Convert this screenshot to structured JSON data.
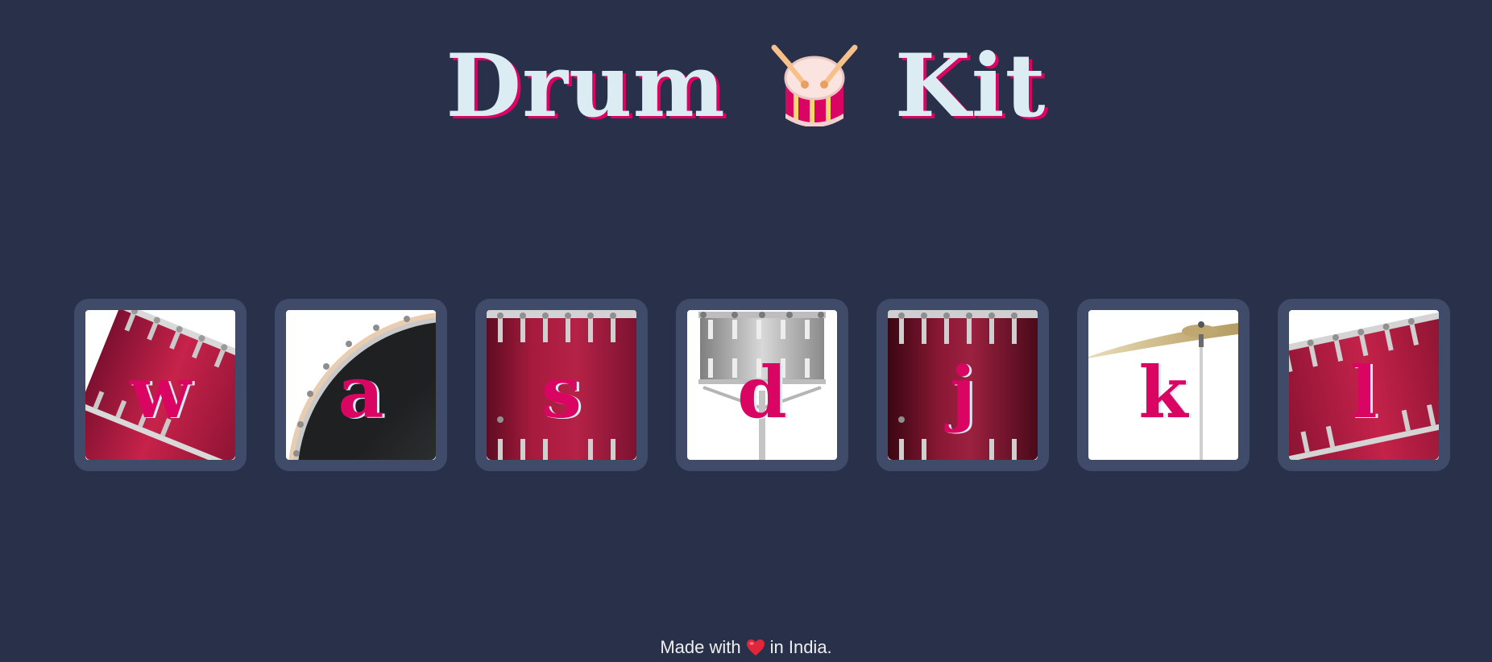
{
  "page": {
    "title_left": "Drum",
    "title_right": "Kit",
    "title_icon": "drum-icon"
  },
  "drums": [
    {
      "key": "w",
      "art": "tom-tilted",
      "label_name": "drum-w"
    },
    {
      "key": "a",
      "art": "crash-drum",
      "label_name": "drum-a"
    },
    {
      "key": "s",
      "art": "snare-red",
      "label_name": "drum-s"
    },
    {
      "key": "d",
      "art": "snare-silver",
      "label_name": "drum-d"
    },
    {
      "key": "j",
      "art": "tom-dark",
      "label_name": "drum-j"
    },
    {
      "key": "k",
      "art": "cymbal",
      "label_name": "drum-k"
    },
    {
      "key": "l",
      "art": "kick-tilted",
      "label_name": "drum-l"
    }
  ],
  "footer": {
    "made_with": "Made with",
    "location": "in India.",
    "icon": "heart-icon"
  },
  "colors": {
    "background": "#283149",
    "tile_border": "#404B69",
    "accent": "#DA0463",
    "title_text": "#DBEDF3",
    "footer_text": "#EEEEEE"
  }
}
